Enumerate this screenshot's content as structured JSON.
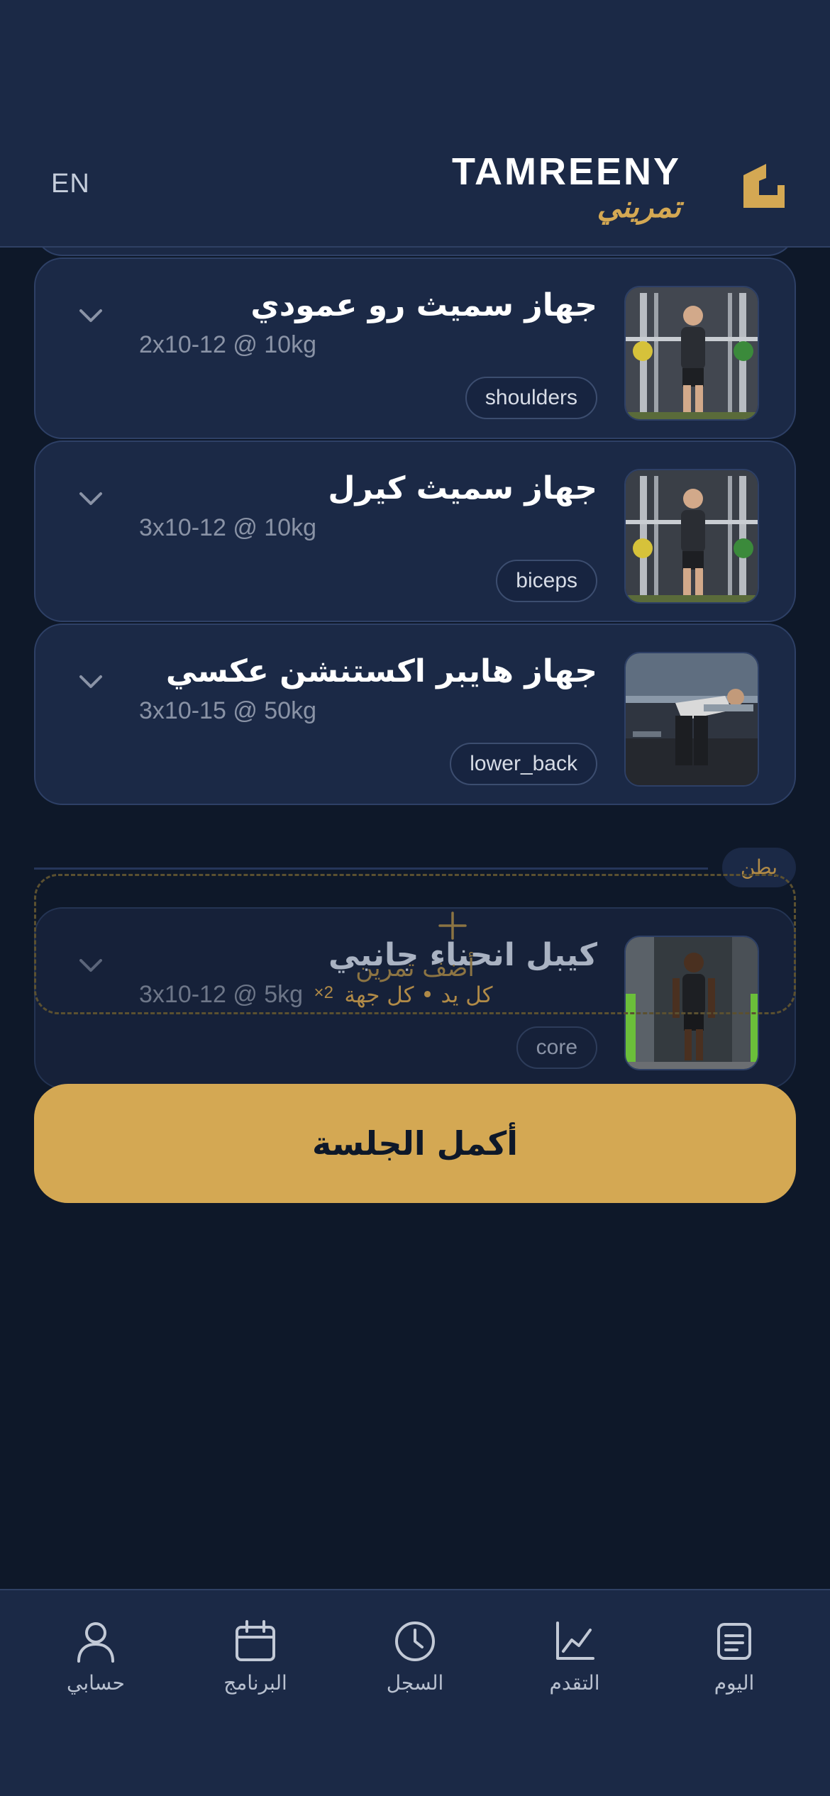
{
  "header": {
    "lang_toggle": "EN",
    "brand_en": "TAMREENY",
    "brand_ar": "تمريني"
  },
  "exercises": [
    {
      "title": "جهاز سميث رو عمودي",
      "prescription": "2x10-12 @ 10kg",
      "tag": "shoulders"
    },
    {
      "title": "جهاز سميث كيرل",
      "prescription": "3x10-12 @ 10kg",
      "tag": "biceps"
    },
    {
      "title": "جهاز هايبر اكستنشن عكسي",
      "prescription": "3x10-15 @ 50kg",
      "tag": "lower_back"
    }
  ],
  "section": {
    "label": "بطن",
    "exercise": {
      "title": "كيبل انحناء جانبي",
      "prescription": "3x10-12 @ 5kg",
      "multiplier": "×2",
      "per_side": "كل يد • كل جهة",
      "tag": "core"
    }
  },
  "add_exercise": {
    "icon": "plus-icon",
    "label": "أضف تمرين"
  },
  "complete_button": "أكمل الجلسة",
  "nav": {
    "today": "اليوم",
    "progress": "التقدم",
    "history": "السجل",
    "program": "البرنامج",
    "account": "حسابي"
  },
  "colors": {
    "accent": "#d4a853",
    "background": "#0e1829",
    "card": "#1b2946"
  }
}
